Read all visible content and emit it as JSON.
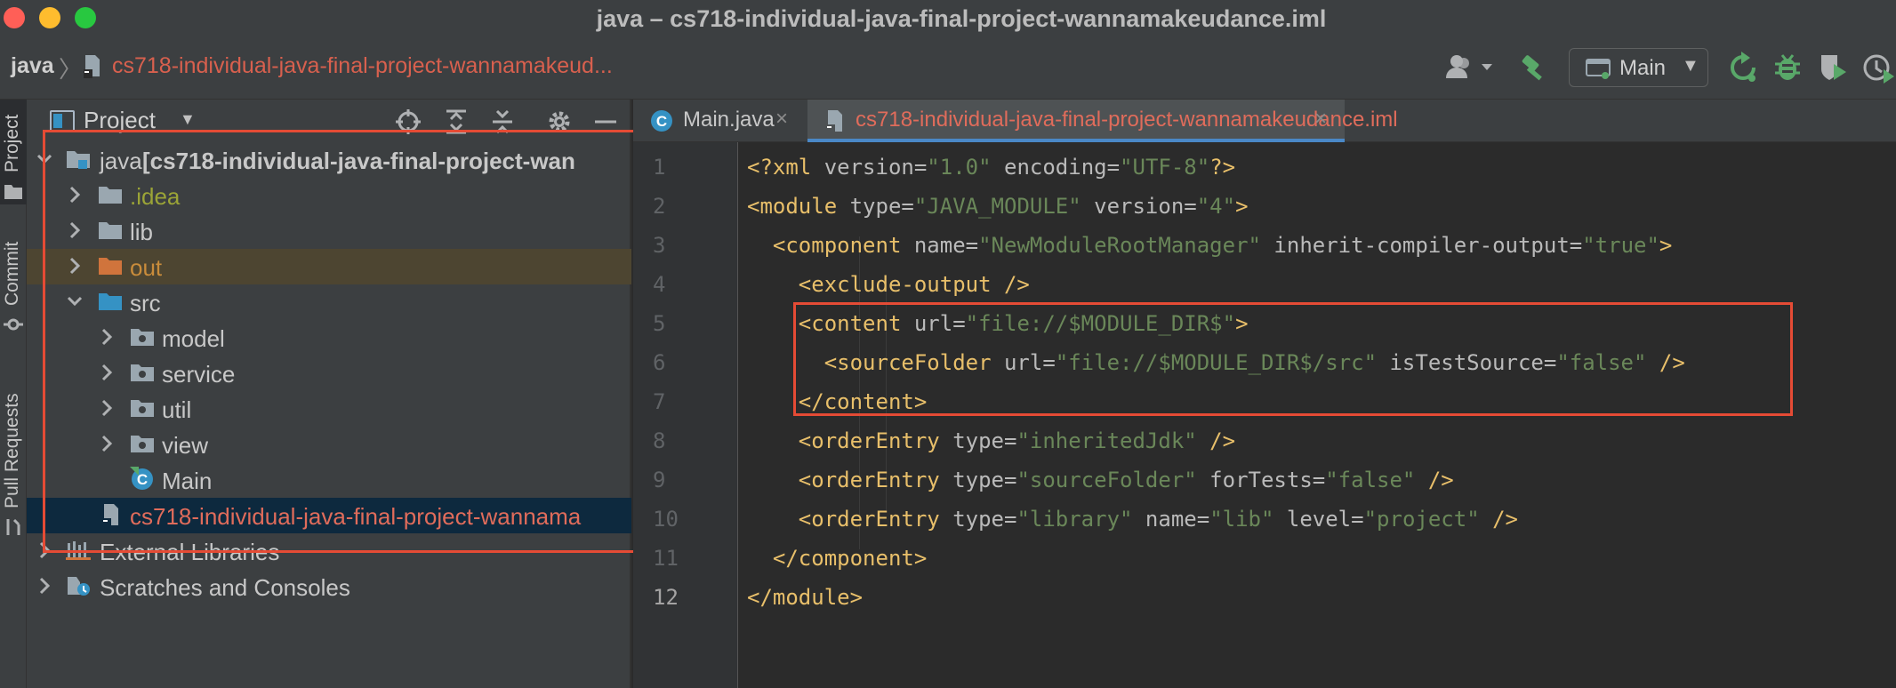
{
  "window": {
    "title": "java – cs718-individual-java-final-project-wannamakeudance.iml"
  },
  "navbar": {
    "root": "java",
    "file": "cs718-individual-java-final-project-wannamakeud...",
    "run_config": "Main"
  },
  "tool_strip": {
    "project": "Project",
    "commit": "Commit",
    "pull_requests": "Pull Requests"
  },
  "project_panel": {
    "title": "Project",
    "root_label": "java",
    "root_module": "[cs718-individual-java-final-project-wan",
    "items": [
      {
        "label": ".idea"
      },
      {
        "label": "lib"
      },
      {
        "label": "out"
      },
      {
        "label": "src"
      },
      {
        "label": "model"
      },
      {
        "label": "service"
      },
      {
        "label": "util"
      },
      {
        "label": "view"
      },
      {
        "label": "Main"
      },
      {
        "label": "cs718-individual-java-final-project-wannama"
      },
      {
        "label": "External Libraries"
      },
      {
        "label": "Scratches and Consoles"
      }
    ]
  },
  "editor": {
    "tabs": [
      {
        "label": "Main.java"
      },
      {
        "label": "cs718-individual-java-final-project-wannamakeudance.iml"
      }
    ],
    "line_numbers": [
      "1",
      "2",
      "3",
      "4",
      "5",
      "6",
      "7",
      "8",
      "9",
      "10",
      "11",
      "12"
    ],
    "lines": [
      [
        {
          "t": "<?xml ",
          "c": "tag"
        },
        {
          "t": "version=",
          "c": "attr"
        },
        {
          "t": "\"1.0\"",
          "c": "val"
        },
        {
          "t": " encoding=",
          "c": "attr"
        },
        {
          "t": "\"UTF-8\"",
          "c": "val"
        },
        {
          "t": "?>",
          "c": "tag"
        }
      ],
      [
        {
          "t": "<module ",
          "c": "tag"
        },
        {
          "t": "type=",
          "c": "attr"
        },
        {
          "t": "\"JAVA_MODULE\"",
          "c": "val"
        },
        {
          "t": " version=",
          "c": "attr"
        },
        {
          "t": "\"4\"",
          "c": "val"
        },
        {
          "t": ">",
          "c": "tag"
        }
      ],
      [
        {
          "t": "  <component ",
          "c": "tag"
        },
        {
          "t": "name=",
          "c": "attr"
        },
        {
          "t": "\"NewModuleRootManager\"",
          "c": "val"
        },
        {
          "t": " inherit-compiler-output=",
          "c": "attr"
        },
        {
          "t": "\"true\"",
          "c": "val"
        },
        {
          "t": ">",
          "c": "tag"
        }
      ],
      [
        {
          "t": "    <exclude-output />",
          "c": "tag"
        }
      ],
      [
        {
          "t": "    <content ",
          "c": "tag"
        },
        {
          "t": "url=",
          "c": "attr"
        },
        {
          "t": "\"file://$MODULE_DIR$\"",
          "c": "val"
        },
        {
          "t": ">",
          "c": "tag"
        }
      ],
      [
        {
          "t": "      <sourceFolder ",
          "c": "tag"
        },
        {
          "t": "url=",
          "c": "attr"
        },
        {
          "t": "\"file://$MODULE_DIR$/src\"",
          "c": "val"
        },
        {
          "t": " isTestSource=",
          "c": "attr"
        },
        {
          "t": "\"false\"",
          "c": "val"
        },
        {
          "t": " />",
          "c": "tag"
        }
      ],
      [
        {
          "t": "    </content>",
          "c": "tag"
        }
      ],
      [
        {
          "t": "    <orderEntry ",
          "c": "tag"
        },
        {
          "t": "type=",
          "c": "attr"
        },
        {
          "t": "\"inheritedJdk\"",
          "c": "val"
        },
        {
          "t": " />",
          "c": "tag"
        }
      ],
      [
        {
          "t": "    <orderEntry ",
          "c": "tag"
        },
        {
          "t": "type=",
          "c": "attr"
        },
        {
          "t": "\"sourceFolder\"",
          "c": "val"
        },
        {
          "t": " forTests=",
          "c": "attr"
        },
        {
          "t": "\"false\"",
          "c": "val"
        },
        {
          "t": " />",
          "c": "tag"
        }
      ],
      [
        {
          "t": "    <orderEntry ",
          "c": "tag"
        },
        {
          "t": "type=",
          "c": "attr"
        },
        {
          "t": "\"library\"",
          "c": "val"
        },
        {
          "t": " name=",
          "c": "attr"
        },
        {
          "t": "\"lib\"",
          "c": "val"
        },
        {
          "t": " level=",
          "c": "attr"
        },
        {
          "t": "\"project\"",
          "c": "val"
        },
        {
          "t": " />",
          "c": "tag"
        }
      ],
      [
        {
          "t": "  </component>",
          "c": "tag"
        }
      ],
      [
        {
          "t": "</module>",
          "c": "tag"
        }
      ]
    ]
  },
  "colors": {
    "accent": "#4a88c7",
    "highlight_box": "#e54b35",
    "file_red": "#e06c5b",
    "xml_tag": "#e8bf6a",
    "xml_value": "#6a8759"
  }
}
